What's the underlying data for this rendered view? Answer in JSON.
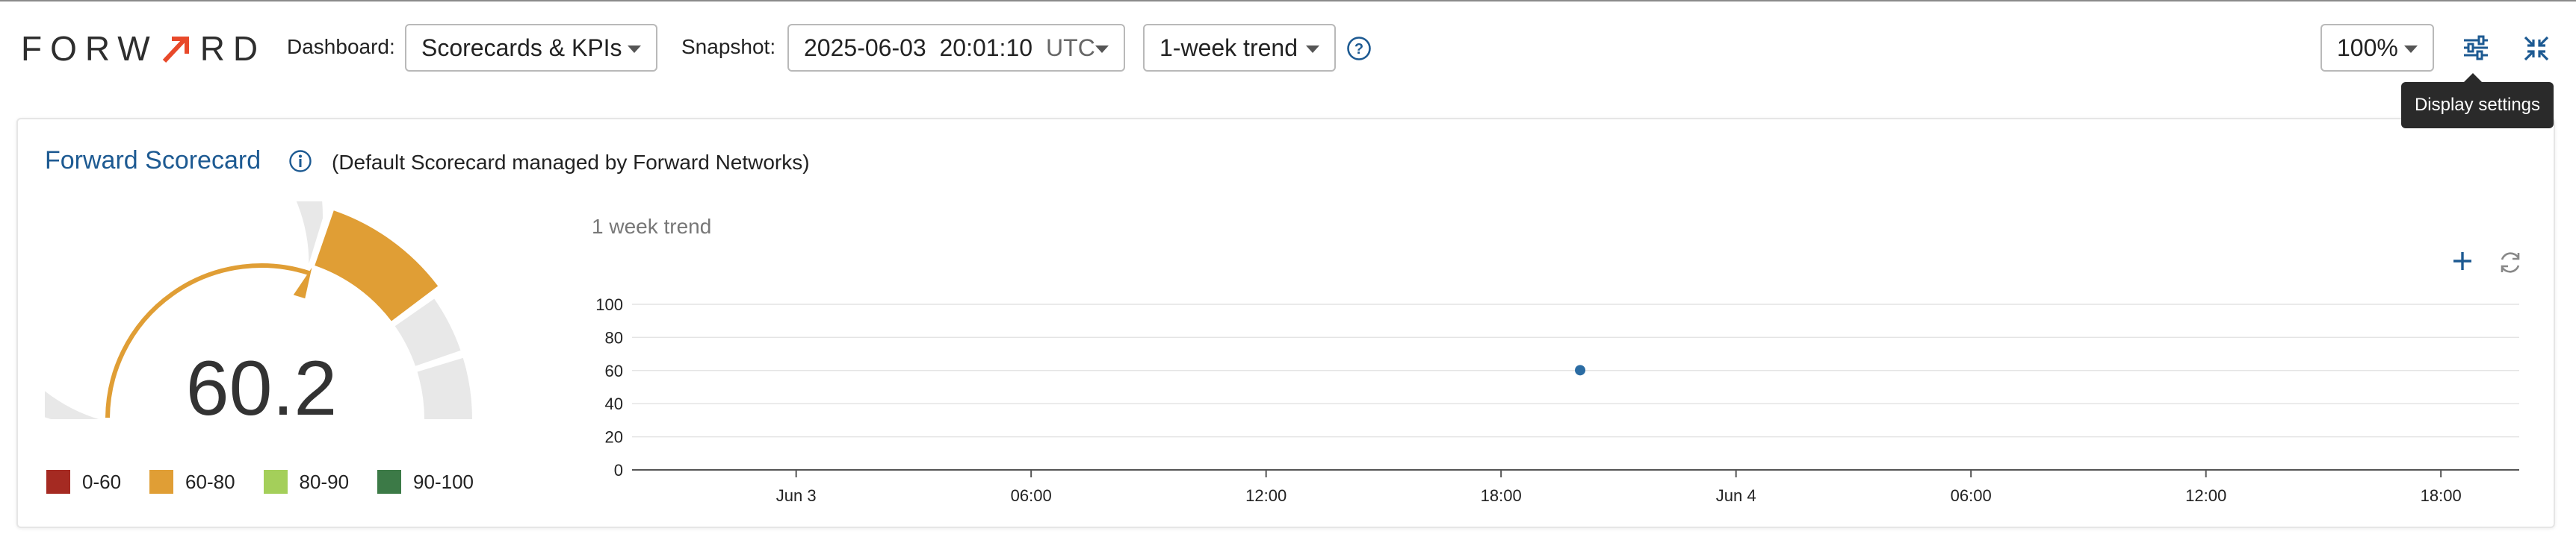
{
  "header": {
    "logo_text_left": "FORW",
    "logo_text_right": "RD",
    "dashboard_label": "Dashboard:",
    "dashboard_value": "Scorecards & KPIs",
    "snapshot_label": "Snapshot:",
    "snapshot_value": "2025-06-03  20:01:10",
    "snapshot_tz": "UTC",
    "trend_value": "1-week trend",
    "zoom_value": "100%",
    "tooltip": "Display settings",
    "icons": [
      "help-icon",
      "display-settings-icon",
      "collapse-icon"
    ]
  },
  "scorecard": {
    "title": "Forward Scorecard",
    "subtitle": "(Default Scorecard managed by Forward Networks)",
    "score": "60.2",
    "score_value": 60.2,
    "legend": [
      {
        "label": "0-60",
        "color": "#a52a22"
      },
      {
        "label": "60-80",
        "color": "#e09e35"
      },
      {
        "label": "80-90",
        "color": "#a4cf5a"
      },
      {
        "label": "90-100",
        "color": "#3c7a47"
      }
    ]
  },
  "trend": {
    "label": "1 week trend",
    "icons": [
      "plus-icon",
      "refresh-icon"
    ]
  },
  "chart_data": {
    "type": "scatter",
    "title": "1 week trend",
    "xlabel": "",
    "ylabel": "",
    "ylim": [
      0,
      100
    ],
    "yticks": [
      0,
      20,
      40,
      60,
      80,
      100
    ],
    "xticks": [
      "Jun 3",
      "06:00",
      "12:00",
      "18:00",
      "Jun 4",
      "06:00",
      "12:00",
      "18:00"
    ],
    "xlim_hours": [
      -4,
      44
    ],
    "xtick_hours": [
      0,
      6,
      12,
      18,
      24,
      30,
      36,
      42
    ],
    "points": [
      {
        "x": "2025-06-03 20:01",
        "x_hours": 20.02,
        "y": 60.2
      }
    ],
    "point_color": "#2b6ca3",
    "grid": true
  }
}
